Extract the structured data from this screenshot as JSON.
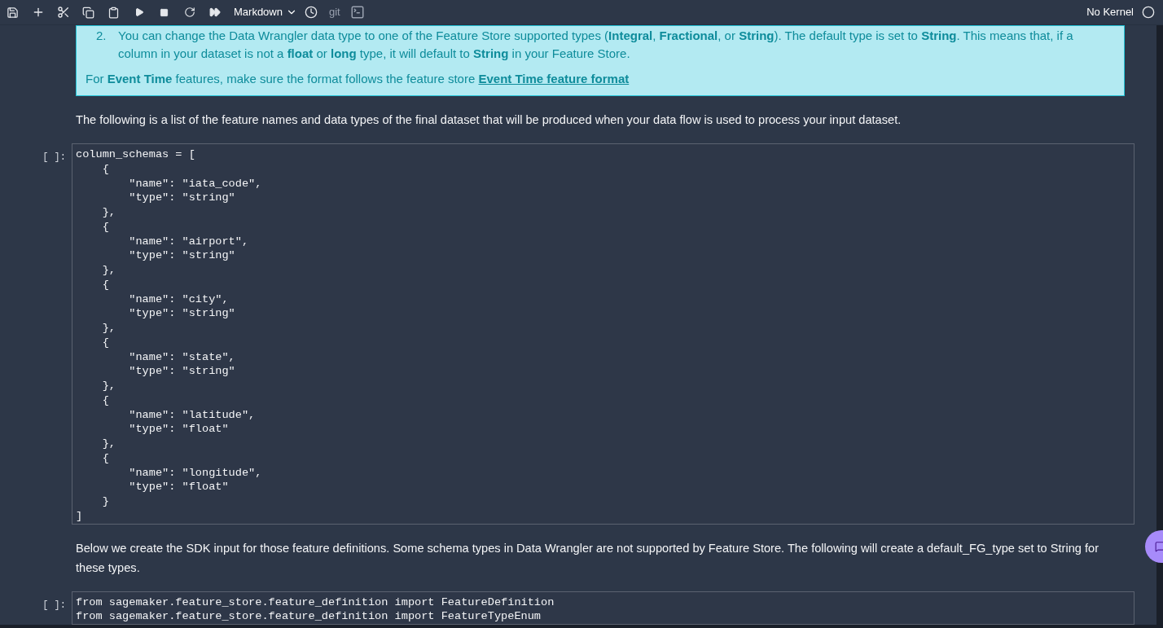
{
  "toolbar": {
    "cell_type": "Markdown",
    "git": "git",
    "kernel": "No Kernel"
  },
  "cells": [
    {
      "kind": "info",
      "number": "2.",
      "item": "You can change the Data Wrangler data type to one of the Feature Store supported types (**Integral**, **Fractional**, or **String**). The default type is set to **String**. This means that, if a column in your dataset is not a **float** or **long** type, it will default to **String** in your Feature Store.",
      "note": "For **Event Time** features, make sure the format follows the feature store ",
      "link": "Event Time feature format"
    },
    {
      "kind": "markdown",
      "text": "The following is a list of the feature names and data types of the final dataset that will be produced when your data flow is used to process your input dataset."
    },
    {
      "kind": "code",
      "prompt": "[ ]:",
      "lines": [
        "column_schemas = [",
        "    {",
        "        \"name\": \"iata_code\",",
        "        \"type\": \"string\"",
        "    },",
        "    {",
        "        \"name\": \"airport\",",
        "        \"type\": \"string\"",
        "    },",
        "    {",
        "        \"name\": \"city\",",
        "        \"type\": \"string\"",
        "    },",
        "    {",
        "        \"name\": \"state\",",
        "        \"type\": \"string\"",
        "    },",
        "    {",
        "        \"name\": \"latitude\",",
        "        \"type\": \"float\"",
        "    },",
        "    {",
        "        \"name\": \"longitude\",",
        "        \"type\": \"float\"",
        "    }",
        "]"
      ]
    },
    {
      "kind": "markdown",
      "text": "Below we create the SDK input for those feature definitions. Some schema types in Data Wrangler are not supported by Feature Store. The following will create a default_FG_type set to String for these types."
    },
    {
      "kind": "code",
      "prompt": "[ ]:",
      "lines": [
        "from sagemaker.feature_store.feature_definition import FeatureDefinition",
        "from sagemaker.feature_store.feature_definition import FeatureTypeEnum"
      ]
    }
  ]
}
